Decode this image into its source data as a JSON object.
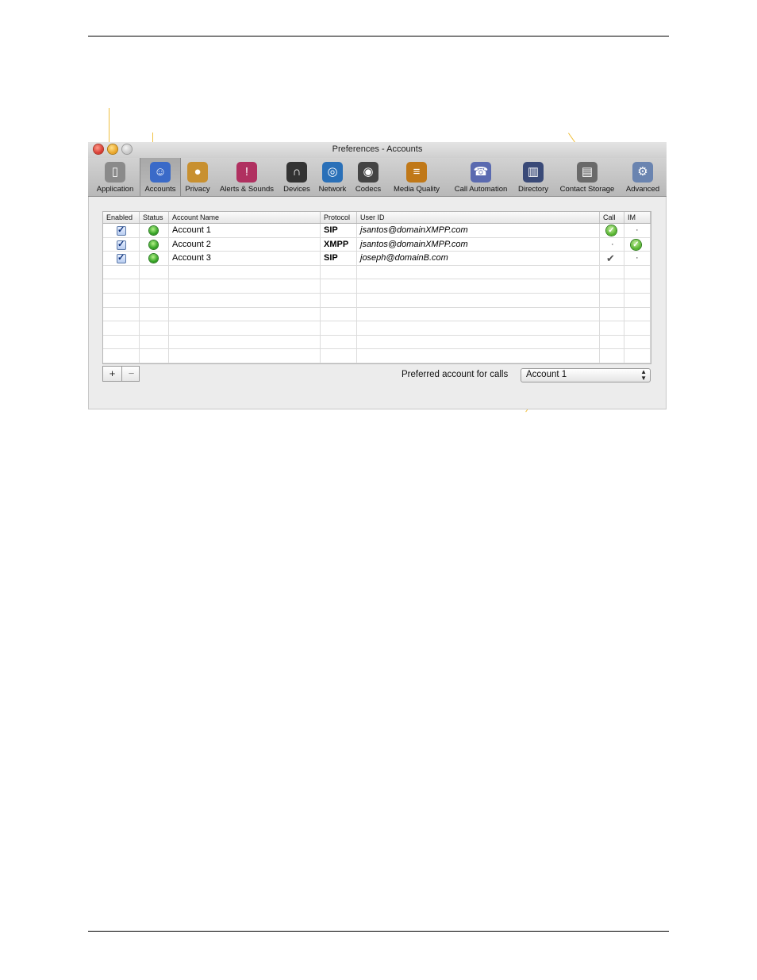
{
  "window": {
    "title": "Preferences - Accounts"
  },
  "toolbar": {
    "items": [
      {
        "label": "Application",
        "icon": "switch-icon",
        "color": "#8a8a8a",
        "glyph": "▯"
      },
      {
        "label": "Accounts",
        "icon": "person-icon",
        "color": "#3a6ac8",
        "glyph": "☺"
      },
      {
        "label": "Privacy",
        "icon": "keyhole-icon",
        "color": "#c89030",
        "glyph": "●"
      },
      {
        "label": "Alerts & Sounds",
        "icon": "exclamation-icon",
        "color": "#b03060",
        "glyph": "!"
      },
      {
        "label": "Devices",
        "icon": "headset-icon",
        "color": "#333333",
        "glyph": "∩"
      },
      {
        "label": "Network",
        "icon": "globe-icon",
        "color": "#2a70b8",
        "glyph": "◎"
      },
      {
        "label": "Codecs",
        "icon": "speaker-icon",
        "color": "#444444",
        "glyph": "◉"
      },
      {
        "label": "Media Quality",
        "icon": "equalizer-icon",
        "color": "#c07818",
        "glyph": "≡"
      },
      {
        "label": "Call Automation",
        "icon": "phone-cog-icon",
        "color": "#5a6ab0",
        "glyph": "☎"
      },
      {
        "label": "Directory",
        "icon": "book-icon",
        "color": "#3a4a78",
        "glyph": "▥"
      },
      {
        "label": "Contact Storage",
        "icon": "storage-icon",
        "color": "#6a6a6a",
        "glyph": "▤"
      },
      {
        "label": "Advanced",
        "icon": "gear-icon",
        "color": "#6a84b0",
        "glyph": "⚙"
      }
    ]
  },
  "table": {
    "headers": [
      "Enabled",
      "Status",
      "Account Name",
      "Protocol",
      "User ID",
      "Call",
      "IM"
    ],
    "rows": [
      {
        "enabled": true,
        "status": "online",
        "name": "Account 1",
        "protocol": "SIP",
        "user_id": "jsantos@domainXMPP.com",
        "call": "green-check",
        "im": "dot"
      },
      {
        "enabled": true,
        "status": "online",
        "name": "Account 2",
        "protocol": "XMPP",
        "user_id": "jsantos@domainXMPP.com",
        "call": "dot",
        "im": "green-check"
      },
      {
        "enabled": true,
        "status": "online",
        "name": "Account 3",
        "protocol": "SIP",
        "user_id": "joseph@domainB.com",
        "call": "grey-check",
        "im": "dot"
      }
    ],
    "empty_rows": 7
  },
  "footer": {
    "add_label": "+",
    "remove_label": "−",
    "preferred_label": "Preferred account for calls",
    "preferred_value": "Account 1"
  },
  "colors": {
    "status_online": "#2fa020",
    "callout": "#f0c040"
  }
}
